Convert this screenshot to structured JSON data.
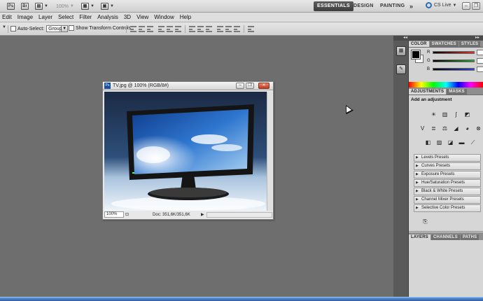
{
  "appbar": {
    "zoom": "100%",
    "workspaces": [
      "ESSENTIALS",
      "DESIGN",
      "PAINTING"
    ],
    "more": "»",
    "cslive": "CS Live"
  },
  "menu": [
    "Edit",
    "Image",
    "Layer",
    "Select",
    "Filter",
    "Analysis",
    "3D",
    "View",
    "Window",
    "Help"
  ],
  "options": {
    "auto_select_label": "Auto-Select:",
    "auto_select_value": "Group",
    "transform_label": "Show Transform Controls"
  },
  "document": {
    "title": "TV.jpg @ 100% (RGB/8#)",
    "zoom": "100%",
    "doc_size": "Doc: 351,6K/351,6K"
  },
  "color_panel": {
    "tabs": [
      "COLOR",
      "SWATCHES",
      "STYLES"
    ],
    "channels": [
      {
        "label": "R",
        "color": "#e03030"
      },
      {
        "label": "G",
        "color": "#30a030"
      },
      {
        "label": "B",
        "color": "#3040d0"
      }
    ],
    "foreground": "#000000",
    "background": "#ffffff"
  },
  "adjustments": {
    "tabs": [
      "ADJUSTMENTS",
      "MASKS"
    ],
    "title": "Add an adjustment",
    "presets": [
      "Levels Presets",
      "Curves Presets",
      "Exposure Presets",
      "Hue/Saturation Presets",
      "Black & White Presets",
      "Channel Mixer Presets",
      "Selective Color Presets"
    ]
  },
  "layers_panel": {
    "tabs": [
      "LAYERS",
      "CHANNELS",
      "PATHS"
    ]
  }
}
